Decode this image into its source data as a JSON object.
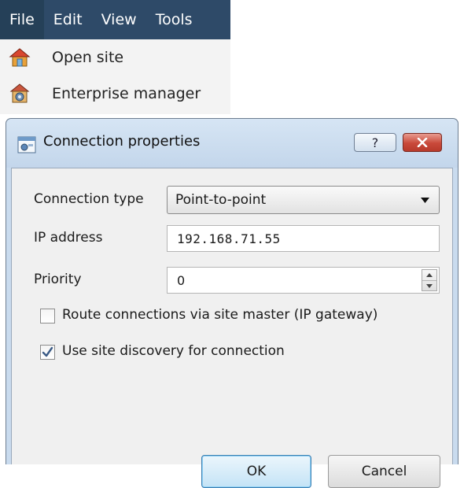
{
  "menu": {
    "items": [
      "File",
      "Edit",
      "View",
      "Tools"
    ],
    "entries": [
      {
        "label": "Open site",
        "icon": "house-icon"
      },
      {
        "label": "Enterprise manager",
        "icon": "enterprise-manager-icon"
      }
    ]
  },
  "dialog": {
    "title": "Connection properties",
    "help_label": "?",
    "fields": {
      "connection_type_label": "Connection type",
      "connection_type_value": "Point-to-point",
      "ip_label": "IP address",
      "ip_value": "192.168.71.55",
      "priority_label": "Priority",
      "priority_value": "0"
    },
    "options": {
      "route_label": "Route connections via site master (IP gateway)",
      "route_checked": false,
      "discovery_label": "Use site discovery for connection",
      "discovery_checked": true
    },
    "buttons": {
      "ok": "OK",
      "cancel": "Cancel"
    }
  },
  "colors": {
    "menubar": "#2e4a68",
    "title_bar": "#c9dbee",
    "close_button": "#c9493a",
    "ok_accent": "#3c7fb1"
  }
}
